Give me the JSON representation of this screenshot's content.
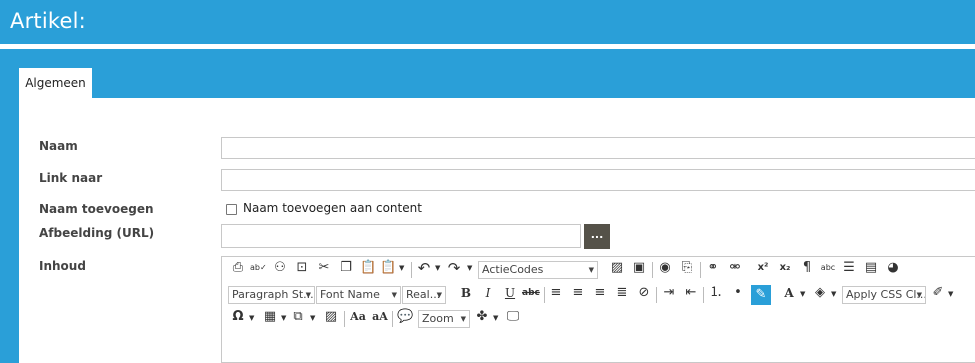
{
  "header": {
    "title": "Artikel:"
  },
  "tabs": [
    {
      "label": "Algemeen",
      "active": true
    }
  ],
  "form": {
    "naam": {
      "label": "Naam",
      "value": ""
    },
    "link": {
      "label": "Link naar",
      "value": ""
    },
    "toevoegen": {
      "label": "Naam toevoegen",
      "checkbox_label": "Naam toevoegen aan content",
      "checked": false
    },
    "afbeelding": {
      "label": "Afbeelding (URL)",
      "value": "",
      "browse_label": "..."
    },
    "inhoud": {
      "label": "Inhoud"
    }
  },
  "editor": {
    "actiecodes": "ActieCodes",
    "paragraph_style": "Paragraph St...",
    "font_name": "Font Name",
    "font_size": "Real...",
    "apply_css": "Apply CSS Cl...",
    "zoom": "Zoom"
  },
  "colors": {
    "accent": "#2a9fd8",
    "browse_button": "#555249"
  }
}
